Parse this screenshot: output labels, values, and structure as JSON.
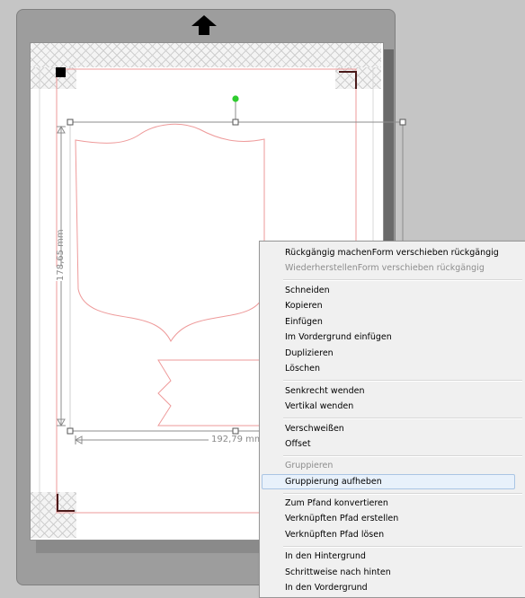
{
  "canvas": {
    "height_dimension": "178,65 mm",
    "width_dimension": "192,79 mm"
  },
  "context_menu": {
    "items": [
      {
        "label": "Rückgängig machenForm verschieben rückgängig",
        "enabled": true
      },
      {
        "label": "WiederherstellenForm verschieben rückgängig",
        "enabled": false
      },
      {
        "label": "Schneiden",
        "enabled": true
      },
      {
        "label": "Kopieren",
        "enabled": true
      },
      {
        "label": "Einfügen",
        "enabled": true
      },
      {
        "label": "Im Vordergrund einfügen",
        "enabled": true
      },
      {
        "label": "Duplizieren",
        "enabled": true
      },
      {
        "label": "Löschen",
        "enabled": true
      },
      {
        "label": "Senkrecht wenden",
        "enabled": true
      },
      {
        "label": "Vertikal wenden",
        "enabled": true
      },
      {
        "label": "Verschweißen",
        "enabled": true
      },
      {
        "label": "Offset",
        "enabled": true
      },
      {
        "label": "Gruppieren",
        "enabled": false
      },
      {
        "label": "Gruppierung aufheben",
        "enabled": true,
        "highlighted": true
      },
      {
        "label": "Zum Pfand konvertieren",
        "enabled": true
      },
      {
        "label": "Verknüpften Pfad erstellen",
        "enabled": true
      },
      {
        "label": "Verknüpften Pfad lösen",
        "enabled": true
      },
      {
        "label": "In den Hintergrund",
        "enabled": true
      },
      {
        "label": "Schrittweise nach hinten",
        "enabled": true
      },
      {
        "label": "In den Vordergrund",
        "enabled": true
      }
    ]
  },
  "colors": {
    "cut_line": "#ee9a9a",
    "rotate_handle": "#2ecc2e",
    "menu_highlight": "#e8f1fb"
  }
}
